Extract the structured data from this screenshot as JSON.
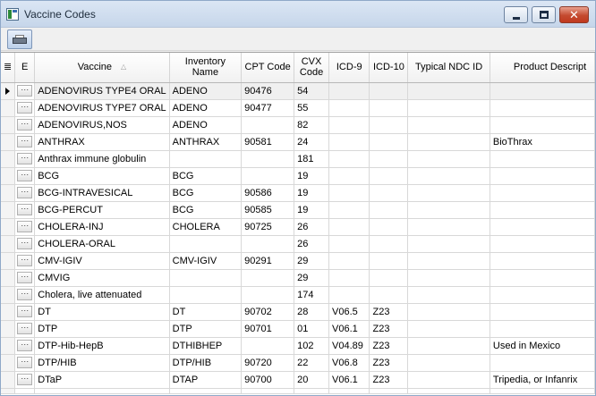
{
  "window": {
    "title": "Vaccine Codes",
    "close_glyph": "✕"
  },
  "toolbar": {
    "print_icon": "printer-icon"
  },
  "table": {
    "columns": {
      "selector_glyph": "≣",
      "e": "E",
      "vaccine": "Vaccine",
      "vaccine_sort_glyph": "△",
      "inventory": "Inventory Name",
      "cpt": "CPT Code",
      "cvx": "CVX Code",
      "icd9": "ICD-9",
      "icd10": "ICD-10",
      "ndc": "Typical NDC ID",
      "desc": "Product Descript"
    },
    "ellipsis": "···",
    "rows": [
      {
        "vaccine": "ADENOVIRUS TYPE4 ORAL",
        "inventory": "ADENO",
        "cpt": "90476",
        "cvx": "54",
        "icd9": "",
        "icd10": "",
        "ndc": "",
        "desc": ""
      },
      {
        "vaccine": "ADENOVIRUS TYPE7 ORAL",
        "inventory": "ADENO",
        "cpt": "90477",
        "cvx": "55",
        "icd9": "",
        "icd10": "",
        "ndc": "",
        "desc": ""
      },
      {
        "vaccine": "ADENOVIRUS,NOS",
        "inventory": "ADENO",
        "cpt": "",
        "cvx": "82",
        "icd9": "",
        "icd10": "",
        "ndc": "",
        "desc": ""
      },
      {
        "vaccine": "ANTHRAX",
        "inventory": "ANTHRAX",
        "cpt": "90581",
        "cvx": "24",
        "icd9": "",
        "icd10": "",
        "ndc": "",
        "desc": "BioThrax"
      },
      {
        "vaccine": "Anthrax immune globulin",
        "inventory": "",
        "cpt": "",
        "cvx": "181",
        "icd9": "",
        "icd10": "",
        "ndc": "",
        "desc": ""
      },
      {
        "vaccine": "BCG",
        "inventory": "BCG",
        "cpt": "",
        "cvx": "19",
        "icd9": "",
        "icd10": "",
        "ndc": "",
        "desc": ""
      },
      {
        "vaccine": "BCG-INTRAVESICAL",
        "inventory": "BCG",
        "cpt": "90586",
        "cvx": "19",
        "icd9": "",
        "icd10": "",
        "ndc": "",
        "desc": ""
      },
      {
        "vaccine": "BCG-PERCUT",
        "inventory": "BCG",
        "cpt": "90585",
        "cvx": "19",
        "icd9": "",
        "icd10": "",
        "ndc": "",
        "desc": ""
      },
      {
        "vaccine": "CHOLERA-INJ",
        "inventory": "CHOLERA",
        "cpt": "90725",
        "cvx": "26",
        "icd9": "",
        "icd10": "",
        "ndc": "",
        "desc": ""
      },
      {
        "vaccine": "CHOLERA-ORAL",
        "inventory": "",
        "cpt": "",
        "cvx": "26",
        "icd9": "",
        "icd10": "",
        "ndc": "",
        "desc": ""
      },
      {
        "vaccine": "CMV-IGIV",
        "inventory": "CMV-IGIV",
        "cpt": "90291",
        "cvx": "29",
        "icd9": "",
        "icd10": "",
        "ndc": "",
        "desc": ""
      },
      {
        "vaccine": "CMVIG",
        "inventory": "",
        "cpt": "",
        "cvx": "29",
        "icd9": "",
        "icd10": "",
        "ndc": "",
        "desc": ""
      },
      {
        "vaccine": "Cholera, live attenuated",
        "inventory": "",
        "cpt": "",
        "cvx": "174",
        "icd9": "",
        "icd10": "",
        "ndc": "",
        "desc": ""
      },
      {
        "vaccine": "DT",
        "inventory": "DT",
        "cpt": "90702",
        "cvx": "28",
        "icd9": "V06.5",
        "icd10": "Z23",
        "ndc": "",
        "desc": ""
      },
      {
        "vaccine": "DTP",
        "inventory": "DTP",
        "cpt": "90701",
        "cvx": "01",
        "icd9": "V06.1",
        "icd10": "Z23",
        "ndc": "",
        "desc": ""
      },
      {
        "vaccine": "DTP-Hib-HepB",
        "inventory": "DTHIBHEP",
        "cpt": "",
        "cvx": "102",
        "icd9": "V04.89",
        "icd10": "Z23",
        "ndc": "",
        "desc": "Used in Mexico"
      },
      {
        "vaccine": "DTP/HIB",
        "inventory": "DTP/HIB",
        "cpt": "90720",
        "cvx": "22",
        "icd9": "V06.8",
        "icd10": "Z23",
        "ndc": "",
        "desc": ""
      },
      {
        "vaccine": "DTaP",
        "inventory": "DTAP",
        "cpt": "90700",
        "cvx": "20",
        "icd9": "V06.1",
        "icd10": "Z23",
        "ndc": "",
        "desc": "Tripedia, or Infanrix"
      }
    ]
  }
}
